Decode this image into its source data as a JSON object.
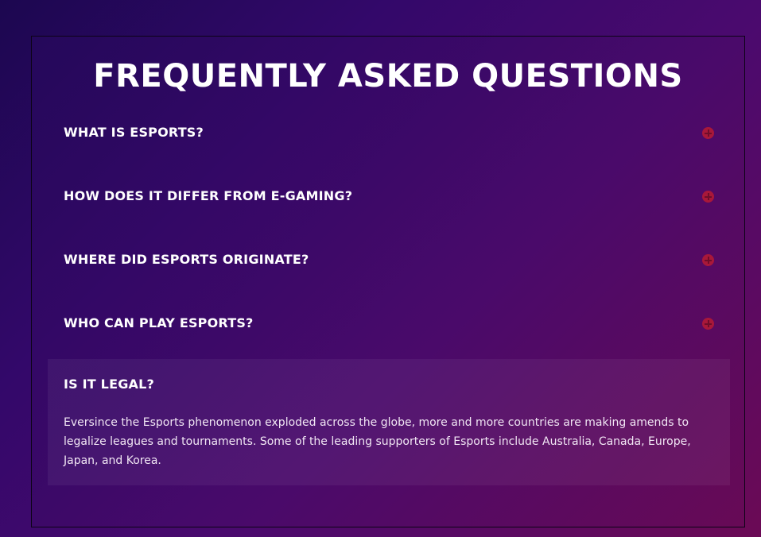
{
  "faq": {
    "title": "FREQUENTLY ASKED QUESTIONS",
    "items": [
      {
        "question": "WHAT IS ESPORTS?",
        "icon": "plus-circle-icon",
        "expanded": false
      },
      {
        "question": "HOW DOES IT DIFFER FROM E-GAMING?",
        "icon": "plus-circle-icon",
        "expanded": false
      },
      {
        "question": "WHERE DID ESPORTS ORIGINATE?",
        "icon": "plus-circle-icon",
        "expanded": false
      },
      {
        "question": "WHO CAN PLAY ESPORTS?",
        "icon": "plus-circle-icon",
        "expanded": false
      },
      {
        "question": "IS IT LEGAL?",
        "expanded": true,
        "answer": "Eversince the Esports phenomenon exploded across the globe, more and more countries are making amends to legalize leagues and tournaments. Some of the leading supporters of Esports include Australia, Canada, Europe, Japan, and Korea."
      }
    ]
  },
  "colors": {
    "icon_accent": "#a8183a",
    "text": "#ffffff"
  }
}
